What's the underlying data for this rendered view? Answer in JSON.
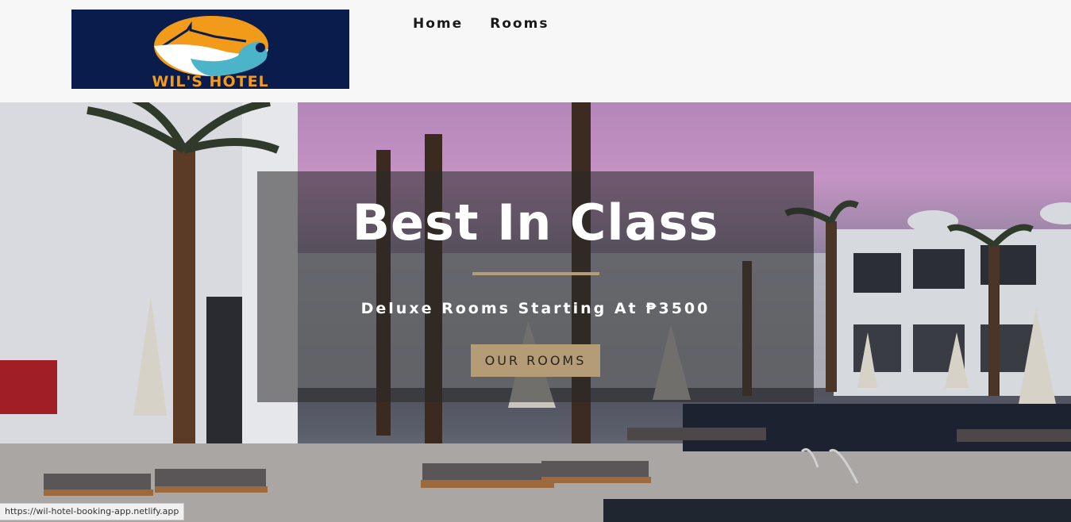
{
  "brand": {
    "name": "WIL'S HOTEL",
    "logo_bg": "#0a1c4c",
    "logo_accent": "#f29a1a",
    "logo_wave": "#4bb4c8"
  },
  "nav": {
    "items": [
      {
        "label": "Home"
      },
      {
        "label": "Rooms"
      }
    ]
  },
  "hero": {
    "title": "Best In Class",
    "subtitle": "Deluxe Rooms Starting At ₱3500",
    "cta_label": "OUR ROOMS",
    "accent_color": "#b39c76",
    "background_description_icon": "resort-pool-photo"
  },
  "status_bar": {
    "url": "https://wil-hotel-booking-app.netlify.app"
  }
}
